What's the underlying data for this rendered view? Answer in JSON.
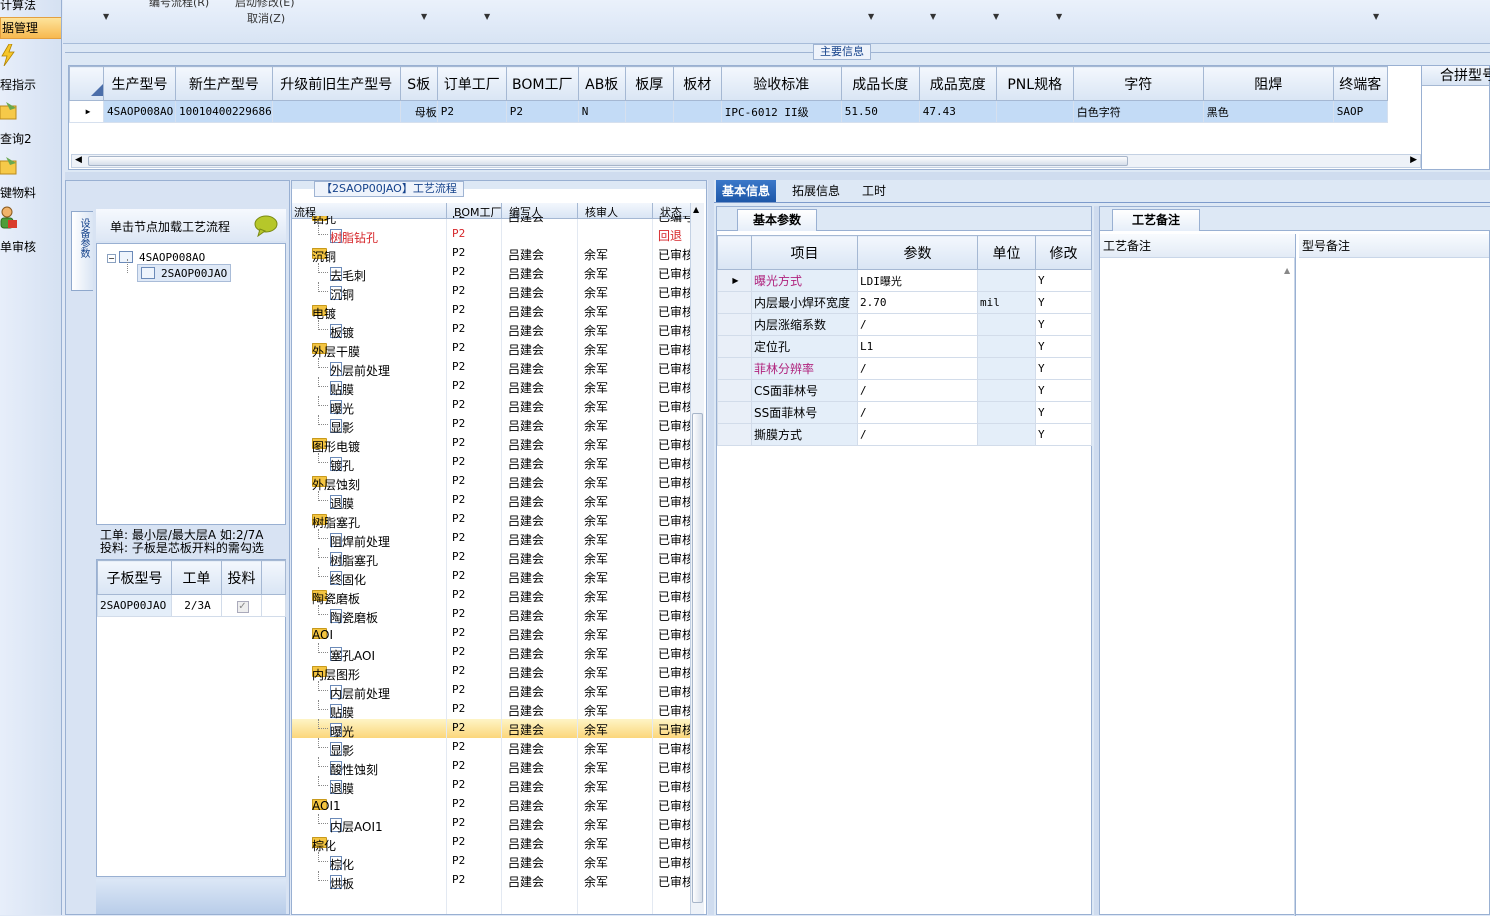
{
  "nav": {
    "items": [
      {
        "label": "计算法",
        "icon": "calculator-icon"
      },
      {
        "label": "据管理",
        "icon": "data-icon",
        "selected": true
      },
      {
        "label": "程指示",
        "icon": "lightning-icon"
      },
      {
        "label": "查询2",
        "icon": "folder-icon"
      },
      {
        "label": "键物料",
        "icon": "folder-icon"
      },
      {
        "label": "单审核",
        "icon": "user-icon"
      }
    ]
  },
  "toolbar": {
    "item1": "编号流程(R)",
    "item2": "启动修改(E)",
    "item3": "取消(Z)"
  },
  "main_info": {
    "title": "主要信息",
    "columns": [
      "生产型号",
      "新生产型号",
      "升级前旧生产型号",
      "S板",
      "订单工厂",
      "BOM工厂",
      "AB板",
      "板厚",
      "板材",
      "验收标准",
      "成品长度",
      "成品宽度",
      "PNL规格",
      "字符",
      "阻焊",
      "终端客"
    ],
    "extra_column": "合拼型号",
    "row": [
      "4SAOP008AO",
      "10010400229686",
      "",
      "母板",
      "P2",
      "P2",
      "N",
      "",
      "",
      "IPC-6012 II级",
      "51.50",
      "47.43",
      "",
      "白色字符",
      "黑色",
      "SAOP"
    ]
  },
  "left_panel": {
    "vertical_tab": "设备参数",
    "hint": "单击节点加载工艺流程",
    "tree": {
      "root": "4SAOP008AO",
      "child": "2SAOP00JAO"
    },
    "note_line1": "工单: 最小层/最大层A 如:2/7A",
    "note_line2": "投料: 子板是芯板开料的需勾选",
    "sub_table": {
      "columns": [
        "子板型号",
        "工单",
        "投料"
      ],
      "rows": [
        {
          "model": "2SAOP00JAO",
          "order": "2/3A",
          "feed": true
        }
      ]
    }
  },
  "process": {
    "title": "【2SAOP00JAO】工艺流程",
    "columns": [
      "流程",
      "BOM工厂",
      "编写人",
      "核审人",
      "状态"
    ],
    "rows": [
      {
        "name": "钻孔",
        "level": 0,
        "bom": "P2",
        "writer": "吕建会",
        "reviewer": "",
        "status": "已编号"
      },
      {
        "name": "树脂钻孔",
        "level": 1,
        "bom": "P2",
        "writer": "",
        "reviewer": "",
        "status": "回退",
        "red": true
      },
      {
        "name": "沉铜",
        "level": 0,
        "bom": "P2",
        "writer": "吕建会",
        "reviewer": "余军",
        "status": "已审核"
      },
      {
        "name": "去毛刺",
        "level": 1,
        "bom": "P2",
        "writer": "吕建会",
        "reviewer": "余军",
        "status": "已审核"
      },
      {
        "name": "沉铜",
        "level": 1,
        "bom": "P2",
        "writer": "吕建会",
        "reviewer": "余军",
        "status": "已审核"
      },
      {
        "name": "电镀",
        "level": 0,
        "bom": "P2",
        "writer": "吕建会",
        "reviewer": "余军",
        "status": "已审核"
      },
      {
        "name": "板镀",
        "level": 1,
        "bom": "P2",
        "writer": "吕建会",
        "reviewer": "余军",
        "status": "已审核"
      },
      {
        "name": "外层干膜",
        "level": 0,
        "bom": "P2",
        "writer": "吕建会",
        "reviewer": "余军",
        "status": "已审核"
      },
      {
        "name": "外层前处理",
        "level": 1,
        "bom": "P2",
        "writer": "吕建会",
        "reviewer": "余军",
        "status": "已审核"
      },
      {
        "name": "贴膜",
        "level": 1,
        "bom": "P2",
        "writer": "吕建会",
        "reviewer": "余军",
        "status": "已审核"
      },
      {
        "name": "曝光",
        "level": 1,
        "bom": "P2",
        "writer": "吕建会",
        "reviewer": "余军",
        "status": "已审核"
      },
      {
        "name": "显影",
        "level": 1,
        "bom": "P2",
        "writer": "吕建会",
        "reviewer": "余军",
        "status": "已审核"
      },
      {
        "name": "图形电镀",
        "level": 0,
        "bom": "P2",
        "writer": "吕建会",
        "reviewer": "余军",
        "status": "已审核"
      },
      {
        "name": "镀孔",
        "level": 1,
        "bom": "P2",
        "writer": "吕建会",
        "reviewer": "余军",
        "status": "已审核"
      },
      {
        "name": "外层蚀刻",
        "level": 0,
        "bom": "P2",
        "writer": "吕建会",
        "reviewer": "余军",
        "status": "已审核"
      },
      {
        "name": "退膜",
        "level": 1,
        "bom": "P2",
        "writer": "吕建会",
        "reviewer": "余军",
        "status": "已审核"
      },
      {
        "name": "树脂塞孔",
        "level": 0,
        "bom": "P2",
        "writer": "吕建会",
        "reviewer": "余军",
        "status": "已审核"
      },
      {
        "name": "阻焊前处理",
        "level": 1,
        "bom": "P2",
        "writer": "吕建会",
        "reviewer": "余军",
        "status": "已审核"
      },
      {
        "name": "树脂塞孔",
        "level": 1,
        "bom": "P2",
        "writer": "吕建会",
        "reviewer": "余军",
        "status": "已审核"
      },
      {
        "name": "终固化",
        "level": 1,
        "bom": "P2",
        "writer": "吕建会",
        "reviewer": "余军",
        "status": "已审核"
      },
      {
        "name": "陶瓷磨板",
        "level": 0,
        "bom": "P2",
        "writer": "吕建会",
        "reviewer": "余军",
        "status": "已审核"
      },
      {
        "name": "陶瓷磨板",
        "level": 1,
        "bom": "P2",
        "writer": "吕建会",
        "reviewer": "余军",
        "status": "已审核"
      },
      {
        "name": "AOI",
        "level": 0,
        "bom": "P2",
        "writer": "吕建会",
        "reviewer": "余军",
        "status": "已审核"
      },
      {
        "name": "塞孔AOI",
        "level": 1,
        "bom": "P2",
        "writer": "吕建会",
        "reviewer": "余军",
        "status": "已审核"
      },
      {
        "name": "内层图形",
        "level": 0,
        "bom": "P2",
        "writer": "吕建会",
        "reviewer": "余军",
        "status": "已审核"
      },
      {
        "name": "内层前处理",
        "level": 1,
        "bom": "P2",
        "writer": "吕建会",
        "reviewer": "余军",
        "status": "已审核"
      },
      {
        "name": "贴膜",
        "level": 1,
        "bom": "P2",
        "writer": "吕建会",
        "reviewer": "余军",
        "status": "已审核"
      },
      {
        "name": "曝光",
        "level": 1,
        "bom": "P2",
        "writer": "吕建会",
        "reviewer": "余军",
        "status": "已审核",
        "selected": true
      },
      {
        "name": "显影",
        "level": 1,
        "bom": "P2",
        "writer": "吕建会",
        "reviewer": "余军",
        "status": "已审核"
      },
      {
        "name": "酸性蚀刻",
        "level": 1,
        "bom": "P2",
        "writer": "吕建会",
        "reviewer": "余军",
        "status": "已审核"
      },
      {
        "name": "退膜",
        "level": 1,
        "bom": "P2",
        "writer": "吕建会",
        "reviewer": "余军",
        "status": "已审核"
      },
      {
        "name": "AOI1",
        "level": 0,
        "bom": "P2",
        "writer": "吕建会",
        "reviewer": "余军",
        "status": "已审核"
      },
      {
        "name": "内层AOI1",
        "level": 1,
        "bom": "P2",
        "writer": "吕建会",
        "reviewer": "余军",
        "status": "已审核"
      },
      {
        "name": "棕化",
        "level": 0,
        "bom": "P2",
        "writer": "吕建会",
        "reviewer": "余军",
        "status": "已审核"
      },
      {
        "name": "棕化",
        "level": 1,
        "bom": "P2",
        "writer": "吕建会",
        "reviewer": "余军",
        "status": "已审核"
      },
      {
        "name": "烘板",
        "level": 1,
        "bom": "P2",
        "writer": "吕建会",
        "reviewer": "余军",
        "status": "已审核"
      }
    ]
  },
  "right": {
    "tabs": [
      "基本信息",
      "拓展信息",
      "工时"
    ],
    "subtab": "基本参数",
    "param_columns": [
      "项目",
      "参数",
      "单位",
      "修改"
    ],
    "params": [
      {
        "item": "曝光方式",
        "value": "LDI曝光",
        "unit": "",
        "modify": "Y",
        "highlight": true
      },
      {
        "item": "内层最小焊环宽度",
        "value": "2.70",
        "unit": "mil",
        "modify": "Y"
      },
      {
        "item": "内层涨缩系数",
        "value": "/",
        "unit": "",
        "modify": "Y"
      },
      {
        "item": "定位孔",
        "value": "L1",
        "unit": "",
        "modify": "Y"
      },
      {
        "item": "菲林分辨率",
        "value": "/",
        "unit": "",
        "modify": "Y",
        "highlight": true
      },
      {
        "item": "CS面菲林号",
        "value": "/",
        "unit": "",
        "modify": "Y"
      },
      {
        "item": "SS面菲林号",
        "value": "/",
        "unit": "",
        "modify": "Y"
      },
      {
        "item": "撕膜方式",
        "value": "/",
        "unit": "",
        "modify": "Y"
      }
    ],
    "notes_tab": "工艺备注",
    "notes_columns": [
      "工艺备注",
      "型号备注"
    ]
  }
}
